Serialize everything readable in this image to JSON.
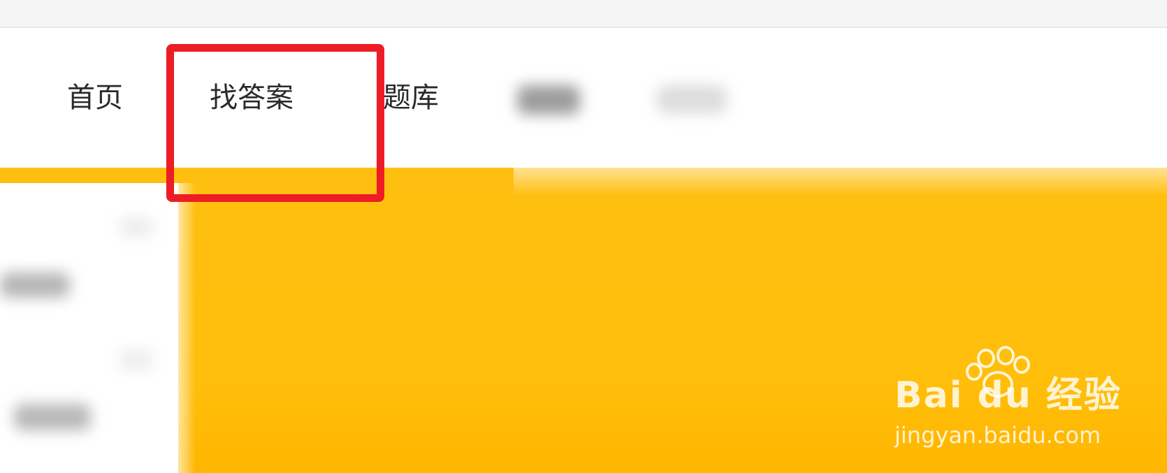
{
  "nav": {
    "items": [
      {
        "label": "首页"
      },
      {
        "label": "找答案"
      },
      {
        "label": "题库"
      }
    ]
  },
  "watermark": {
    "brand": "Bai du 经验",
    "url": "jingyan.baidu.com"
  },
  "colors": {
    "accent_yellow": "#ffbf10",
    "highlight_red": "#ee1c25",
    "link_green": "#21b34a",
    "topbar_bg": "#f5f5f5"
  }
}
